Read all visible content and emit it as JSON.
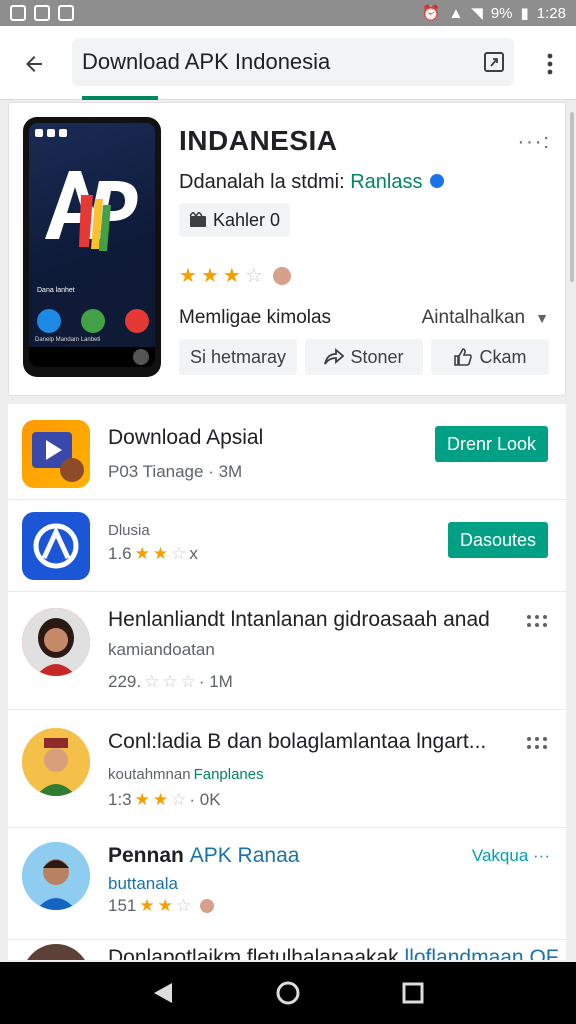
{
  "status_bar": {
    "battery": "9%",
    "time": "1:28"
  },
  "app_bar": {
    "search_text": "Download APK Indonesia"
  },
  "featured": {
    "title": "INDANESIA",
    "dev_prefix": "Ddanalah la stdmi:",
    "dev_name": "Ranlass",
    "chip_label": "Kahler 0",
    "phone_caption": "Dana lanhet",
    "phone_app_labels": "Danelp   Mandam   Lanbeti",
    "update_label": "Memligae kimolas",
    "update_value": "Aintalhalkan",
    "actions": [
      {
        "label": "Si hetmaray"
      },
      {
        "label": "Stoner"
      },
      {
        "label": "Ckam"
      }
    ]
  },
  "list": [
    {
      "title": "Download Apsial",
      "sub": "P03 Tianage · 3M",
      "button": "Drenr Look"
    },
    {
      "title": "Dlusia",
      "rating_text": "1.6",
      "sub_tail": "x",
      "button": "Dasoutes"
    },
    {
      "title": "Henlanliandt lntanlanan gidroasaah anad",
      "line2": "kamiandoatan",
      "sub": "229.",
      "sub_tail": "· 1M"
    },
    {
      "title": "Conl:ladia B dan bolaglamlantaa lngart...",
      "line2_prefix": "koutahmnan",
      "line2_link": "Fanplanes",
      "rating_text": "1:3",
      "sub_tail": "· 0K"
    },
    {
      "title_prefix": "Pennan",
      "title_link": "APK Ranaa",
      "line2": "buttanala",
      "rating_text": "151",
      "link_label": "Vakqua ···"
    },
    {
      "title_prefix": "Donlapotlaikm fletulhalanaakak",
      "title_link": "lloflandmaan OF"
    }
  ],
  "colors": {
    "accent": "#01875f",
    "button": "#01a085",
    "star": "#f4a100",
    "status_bar": "#8e8e8e"
  }
}
